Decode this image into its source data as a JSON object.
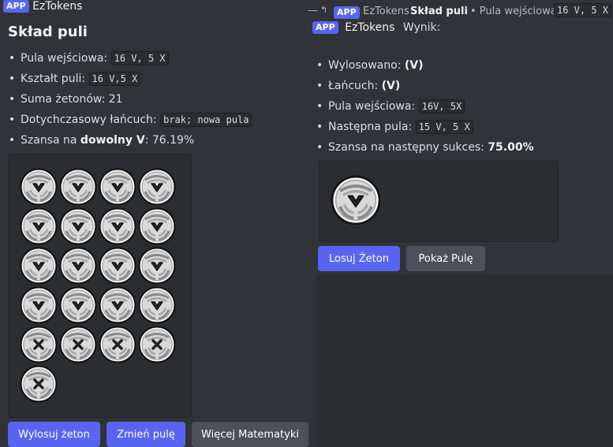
{
  "left": {
    "app_badge": "APP",
    "bot_name": "EzTokens",
    "title": "Skład puli",
    "info": {
      "input_pool_label": "Pula wejściowa: ",
      "input_pool_value": "16 V, 5 X",
      "shape_label": "Kształt puli: ",
      "shape_value": "16 V,5 X",
      "sum_label": "Suma żetonów: ",
      "sum_value": "21",
      "chain_label": "Dotychczasowy łańcuch: ",
      "chain_value": "brak; nowa pula",
      "chance_label": "Szansa na ",
      "chance_bold": "dowolny V",
      "chance_value": ": 76.19%"
    },
    "tokens": [
      "V",
      "V",
      "V",
      "V",
      "V",
      "V",
      "V",
      "V",
      "V",
      "V",
      "V",
      "V",
      "V",
      "V",
      "V",
      "V",
      "X",
      "X",
      "X",
      "X",
      "X"
    ],
    "buttons": {
      "draw": "Wylosuj żeton",
      "change": "Zmień pulę",
      "math": "Więcej Matematyki"
    }
  },
  "right": {
    "reply": {
      "app_badge": "APP",
      "bot_name": "EzTokens",
      "title": "Skład puli",
      "pool_label": "• Pula wejściowa:",
      "pool_value": "16 V, 5 X"
    },
    "app_badge": "APP",
    "bot_name": "EzTokens",
    "result_label": "Wynik:",
    "info": {
      "drawn_label": "Wylosowano: ",
      "drawn_value": "(V)",
      "chain_label": "Łańcuch: ",
      "chain_value": "(V)",
      "input_pool_label": "Pula wejściowa: ",
      "input_pool_value": "16V, 5X",
      "next_pool_label": "Następna pula: ",
      "next_pool_value": "15 V, 5 X",
      "next_chance_label": "Szansa na następny sukces: ",
      "next_chance_value": "75.00%"
    },
    "drawn_token": "V",
    "buttons": {
      "draw": "Losuj Żeton",
      "show": "Pokaż Pulę"
    }
  },
  "colors": {
    "blurple": "#5865f2",
    "secondary": "#4e5058",
    "bg": "#313338",
    "embed_bg": "#2b2d31"
  }
}
